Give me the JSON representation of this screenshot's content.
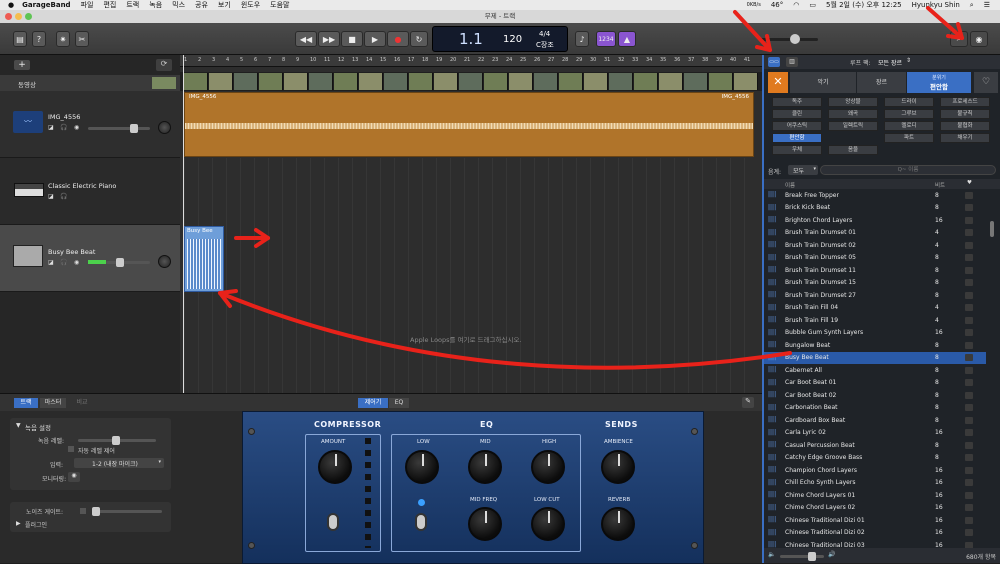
{
  "menubar": {
    "apple": "",
    "items": [
      "GarageBand",
      "파일",
      "편집",
      "트랙",
      "녹음",
      "믹스",
      "공유",
      "보기",
      "윈도우",
      "도움말"
    ],
    "right": {
      "battery_percent": "46°",
      "date": "5월 2일 (수) 오후 12:25",
      "user": "Hyunkyu Shin",
      "status_small": "0KB/s"
    }
  },
  "window": {
    "title": "무제 - 트랙"
  },
  "toolbar": {
    "lcd": {
      "bar": "1.1",
      "tempo": "120",
      "signature": "4/4",
      "key": "C장조"
    },
    "count_in": "1234",
    "metronome_label": "metronome"
  },
  "left_panel": {
    "add_button": "+",
    "movie_label": "동영상",
    "tracks": [
      {
        "name": "IMG_4556"
      },
      {
        "name": "Classic Electric Piano"
      },
      {
        "name": "Busy Bee Beat"
      }
    ]
  },
  "timeline": {
    "ruler": [
      "1",
      "2",
      "3",
      "4",
      "5",
      "6",
      "7",
      "8",
      "9",
      "10",
      "11",
      "12",
      "13",
      "14",
      "15",
      "16",
      "17",
      "18",
      "19",
      "20",
      "21",
      "22",
      "23",
      "24",
      "25",
      "26",
      "27",
      "28",
      "29",
      "30",
      "31",
      "32",
      "33",
      "34",
      "35",
      "36",
      "37",
      "38",
      "39",
      "40",
      "41"
    ],
    "audio_region": "IMG_4556",
    "loop_region": "Busy Bee",
    "drop_hint": "Apple Loops를 여기로 드래그하십시오."
  },
  "bottom_panel": {
    "tabs": [
      "트랙",
      "마스터",
      "비교"
    ],
    "settings_header": "녹음 설정",
    "record_level_label": "녹음 레벨:",
    "auto_level_label": "자동 레벨 제어",
    "input_label": "입력:",
    "input_value": "1-2 (내장 마이크)",
    "monitoring_label": "모니터링:",
    "noise_gate_label": "노이즈 게이트:",
    "plugins_label": "플러그인",
    "plugin_tabs": [
      "제어기",
      "EQ"
    ],
    "plugin": {
      "compressor": "COMPRESSOR",
      "amount": "AMOUNT",
      "eq": "EQ",
      "low": "LOW",
      "mid": "MID",
      "high": "HIGH",
      "mid_freq": "MID FREQ",
      "low_cut": "LOW CUT",
      "sends": "SENDS",
      "ambience": "AMBIENCE",
      "reverb": "REVERB"
    }
  },
  "browser": {
    "loop_pack_label": "루프 팩:",
    "loop_pack_value": "모든 장르",
    "tabs": [
      "악기",
      "장르",
      "분위기\n편안함"
    ],
    "mood_tab_top": "분위기",
    "mood_tab_bottom": "편안함",
    "categories": [
      [
        "독주",
        "앙상블",
        "드라이",
        "프로세스드"
      ],
      [
        "클린",
        "왜곡",
        "그루브",
        "불규칙"
      ],
      [
        "어쿠스틱",
        "일렉트릭",
        "멜로디",
        "불협화"
      ],
      [
        "편안함",
        "",
        "파트",
        "채우기"
      ],
      [
        "우체",
        "음울",
        "",
        ""
      ]
    ],
    "scale_label": "음계:",
    "scale_value": "모두",
    "search_placeholder": "Q~ 이름",
    "col_name": "이름",
    "col_beats": "비트",
    "loops": [
      {
        "name": "Break Free Topper",
        "beats": "8"
      },
      {
        "name": "Brick Kick Beat",
        "beats": "8"
      },
      {
        "name": "Brighton Chord Layers",
        "beats": "16"
      },
      {
        "name": "Brush Train Drumset 01",
        "beats": "4"
      },
      {
        "name": "Brush Train Drumset 02",
        "beats": "4"
      },
      {
        "name": "Brush Train Drumset 05",
        "beats": "8"
      },
      {
        "name": "Brush Train Drumset 11",
        "beats": "8"
      },
      {
        "name": "Brush Train Drumset 15",
        "beats": "8"
      },
      {
        "name": "Brush Train Drumset 27",
        "beats": "8"
      },
      {
        "name": "Brush Train Fill 04",
        "beats": "4"
      },
      {
        "name": "Brush Train Fill 19",
        "beats": "4"
      },
      {
        "name": "Bubble Gum Synth Layers",
        "beats": "16"
      },
      {
        "name": "Bungalow Beat",
        "beats": "8"
      },
      {
        "name": "Busy Bee Beat",
        "beats": "8"
      },
      {
        "name": "Cabernet All",
        "beats": "8"
      },
      {
        "name": "Car Boot Beat 01",
        "beats": "8"
      },
      {
        "name": "Car Boot Beat 02",
        "beats": "8"
      },
      {
        "name": "Carbonation Beat",
        "beats": "8"
      },
      {
        "name": "Cardboard Box Beat",
        "beats": "8"
      },
      {
        "name": "Carla Lyric 02",
        "beats": "16"
      },
      {
        "name": "Casual Percussion Beat",
        "beats": "8"
      },
      {
        "name": "Catchy Edge Groove Bass",
        "beats": "8"
      },
      {
        "name": "Champion Chord Layers",
        "beats": "16"
      },
      {
        "name": "Chill Echo Synth Layers",
        "beats": "16"
      },
      {
        "name": "Chime Chord Layers 01",
        "beats": "16"
      },
      {
        "name": "Chime Chord Layers 02",
        "beats": "16"
      },
      {
        "name": "Chinese Traditional Dizi 01",
        "beats": "16"
      },
      {
        "name": "Chinese Traditional Dizi 02",
        "beats": "16"
      },
      {
        "name": "Chinese Traditional Dizi 03",
        "beats": "16"
      }
    ],
    "item_count": "680개 항목"
  },
  "colors": {
    "accent": "#3a6fc4",
    "orange": "#e07a1f",
    "audio_region": "#b0742a",
    "selected_row": "#2a5aa8",
    "annotation_red": "#e8221a"
  }
}
